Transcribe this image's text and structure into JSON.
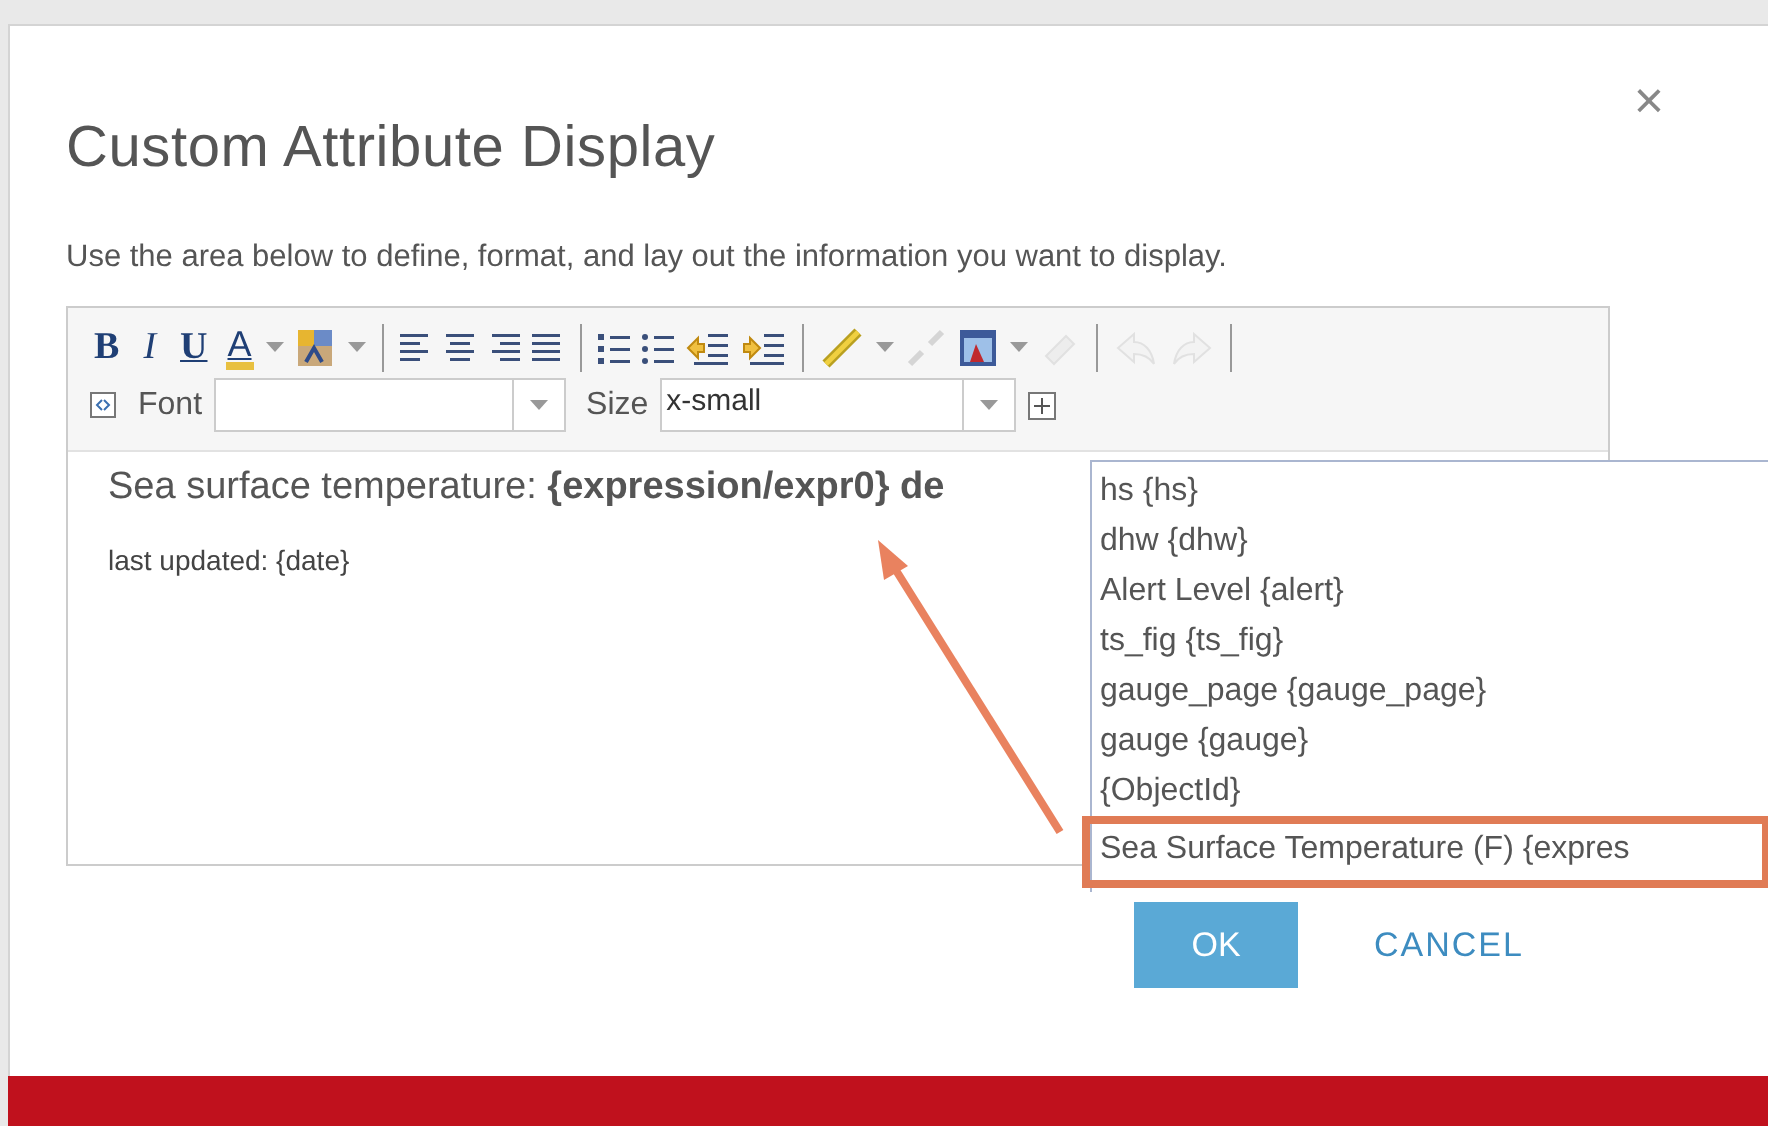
{
  "dialog": {
    "title": "Custom Attribute Display",
    "close": "×",
    "description": "Use the area below to define, format, and lay out the information you want to display."
  },
  "toolbar": {
    "row1": [
      {
        "kind": "bold",
        "label": "B"
      },
      {
        "kind": "italic",
        "label": "I"
      },
      {
        "kind": "underline",
        "label": "U"
      },
      {
        "kind": "fontcolor",
        "label": "A"
      },
      {
        "kind": "caret"
      },
      {
        "kind": "bgcolor"
      },
      {
        "kind": "caret"
      },
      {
        "kind": "sep"
      },
      {
        "kind": "alignleft"
      },
      {
        "kind": "aligncenter"
      },
      {
        "kind": "alignright"
      },
      {
        "kind": "justify"
      },
      {
        "kind": "sep"
      },
      {
        "kind": "olist"
      },
      {
        "kind": "ulist"
      },
      {
        "kind": "indent"
      },
      {
        "kind": "outdent"
      },
      {
        "kind": "sep"
      },
      {
        "kind": "link"
      },
      {
        "kind": "caret"
      },
      {
        "kind": "unlink",
        "disabled": true
      },
      {
        "kind": "image"
      },
      {
        "kind": "caret"
      },
      {
        "kind": "eraser",
        "disabled": true
      },
      {
        "kind": "sep"
      },
      {
        "kind": "undo",
        "disabled": true
      },
      {
        "kind": "redo",
        "disabled": true
      },
      {
        "kind": "sep"
      }
    ],
    "font_label": "Font",
    "size_label": "Size",
    "size_value": "x-small"
  },
  "editor": {
    "lines": [
      {
        "text": "Sea surface temperature: **{expression/expr0} de**",
        "kind": "heading"
      },
      {
        "text": "last updated: {date}",
        "kind": "body"
      }
    ]
  },
  "field_list": {
    "items": [
      {
        "label": "hs {hs}",
        "selected": false
      },
      {
        "label": "dhw {dhw}",
        "selected": false
      },
      {
        "label": "Alert Level {alert}",
        "selected": false
      },
      {
        "label": "ts_fig {ts_fig}",
        "selected": false
      },
      {
        "label": "gauge_page {gauge_page}",
        "selected": false
      },
      {
        "label": "gauge {gauge}",
        "selected": false
      },
      {
        "label": "{ObjectId}",
        "selected": false
      },
      {
        "label": "Sea Surface Temperature (F) {expres",
        "selected": true
      }
    ]
  },
  "buttons": [
    {
      "label": "OK",
      "kind": "primary"
    },
    {
      "label": "CANCEL",
      "kind": "secondary"
    }
  ]
}
